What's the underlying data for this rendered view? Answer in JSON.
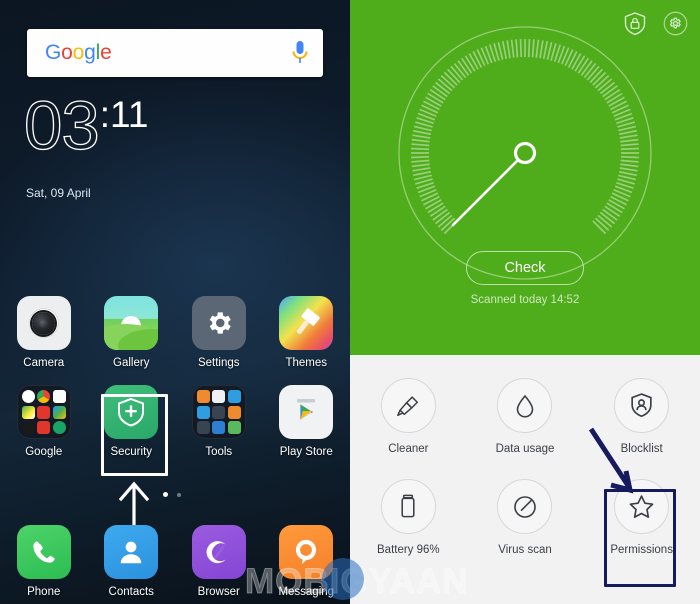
{
  "home": {
    "search": {
      "logo": "Google",
      "logo_letters": [
        "G",
        "o",
        "o",
        "g",
        "l",
        "e"
      ],
      "mic_icon": "microphone-icon"
    },
    "clock": {
      "hours": "03",
      "separator": ":",
      "minutes": "11",
      "date": "Sat, 09 April"
    },
    "apps_row1": [
      {
        "label": "Camera",
        "icon": "camera-icon"
      },
      {
        "label": "Gallery",
        "icon": "gallery-icon"
      },
      {
        "label": "Settings",
        "icon": "gear-icon"
      },
      {
        "label": "Themes",
        "icon": "paintbrush-icon"
      }
    ],
    "apps_row2": [
      {
        "label": "Google",
        "icon": "google-folder-icon"
      },
      {
        "label": "Security",
        "icon": "shield-plus-icon"
      },
      {
        "label": "Tools",
        "icon": "tools-folder-icon"
      },
      {
        "label": "Play Store",
        "icon": "play-store-icon"
      }
    ],
    "dock": [
      {
        "label": "Phone",
        "icon": "phone-icon"
      },
      {
        "label": "Contacts",
        "icon": "person-icon"
      },
      {
        "label": "Browser",
        "icon": "browser-swirl-icon"
      },
      {
        "label": "Messaging",
        "icon": "messaging-icon"
      }
    ],
    "page_dots": {
      "total": 2,
      "active": 1
    },
    "highlight": {
      "target": "Security",
      "annotation_icon": "up-arrow-annotation",
      "color": "#ffffff"
    }
  },
  "security": {
    "top_icons": [
      {
        "name": "shield-lock-icon"
      },
      {
        "name": "gear-circle-icon"
      }
    ],
    "gauge": {
      "needle_value_deg": 225,
      "accent": "#4fad1b"
    },
    "check_button": "Check",
    "scan_status": "Scanned today 14:52",
    "tiles": [
      {
        "label": "Cleaner",
        "icon": "brush-icon"
      },
      {
        "label": "Data usage",
        "icon": "droplet-icon"
      },
      {
        "label": "Blocklist",
        "icon": "shield-person-icon"
      },
      {
        "label": "Battery 96%",
        "icon": "battery-icon"
      },
      {
        "label": "Virus scan",
        "icon": "circle-slash-icon"
      },
      {
        "label": "Permissions",
        "icon": "star-icon"
      }
    ],
    "highlight": {
      "target": "Permissions",
      "annotation_icon": "down-arrow-annotation",
      "color": "#151b5e"
    }
  },
  "watermark": {
    "text": "MOBIGYAAN"
  }
}
